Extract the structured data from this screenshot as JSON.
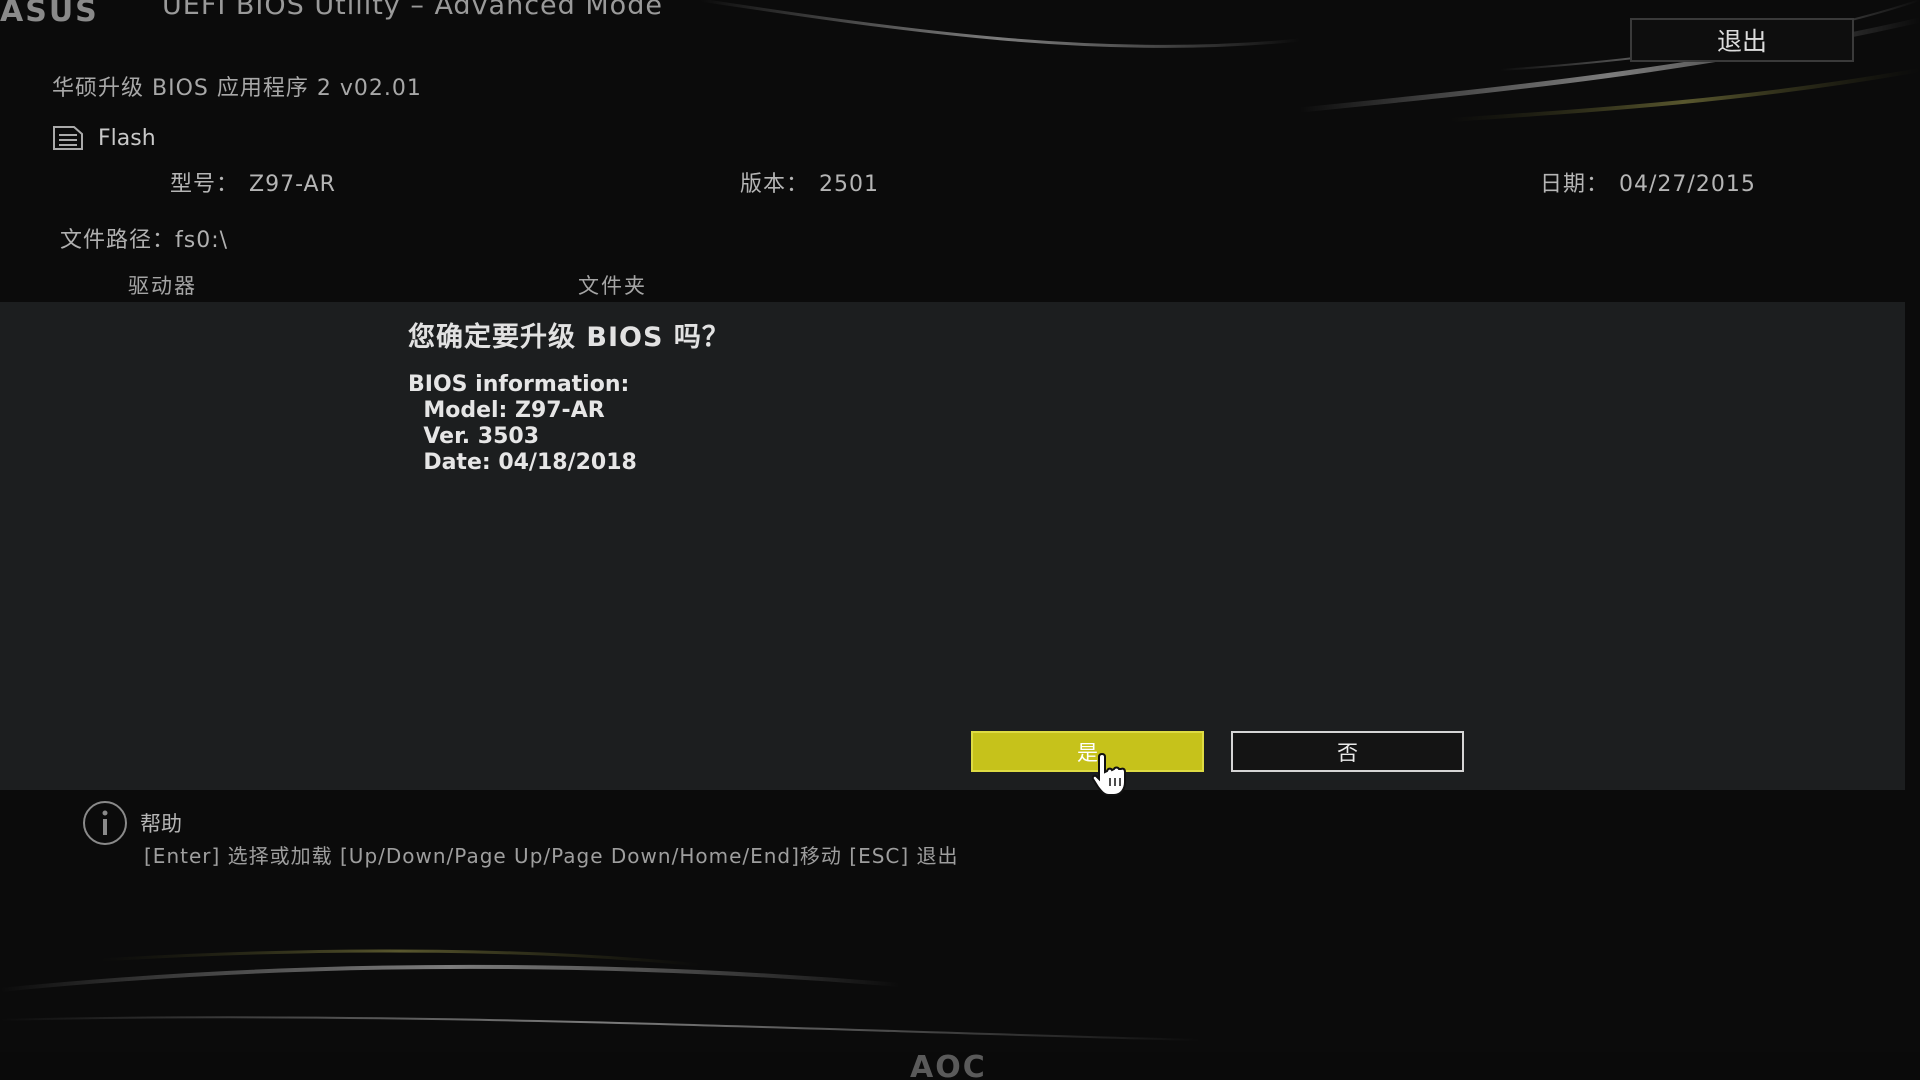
{
  "header": {
    "logo": "ASUS",
    "title": "UEFI BIOS Utility – Advanced Mode",
    "exit_label": "退出"
  },
  "utility": {
    "name": "华硕升级 BIOS 应用程序 2 v02.01",
    "flash_label": "Flash"
  },
  "current_bios": {
    "model_label": "型号：",
    "model_value": "Z97-AR",
    "version_label": "版本：",
    "version_value": "2501",
    "date_label": "日期：",
    "date_value": "04/27/2015"
  },
  "file_path": "文件路径：fs0:\\",
  "columns": {
    "drive": "驱动器",
    "folder": "文件夹"
  },
  "dialog": {
    "question": "您确定要升级 BIOS 吗？",
    "info_header": "BIOS information:",
    "model_line": "  Model: Z97-AR",
    "ver_line": "  Ver. 3503",
    "date_line": "  Date: 04/18/2018",
    "yes_label": "是",
    "no_label": "否"
  },
  "help": {
    "title": "帮助",
    "text": "[Enter] 选择或加载 [Up/Down/Page Up/Page Down/Home/End]移动 [ESC] 退出"
  },
  "monitor": {
    "brand": "AOC"
  },
  "colors": {
    "yes_button": "#c6c21b",
    "panel": "#1c1e1f",
    "background": "#0b0b0b"
  }
}
